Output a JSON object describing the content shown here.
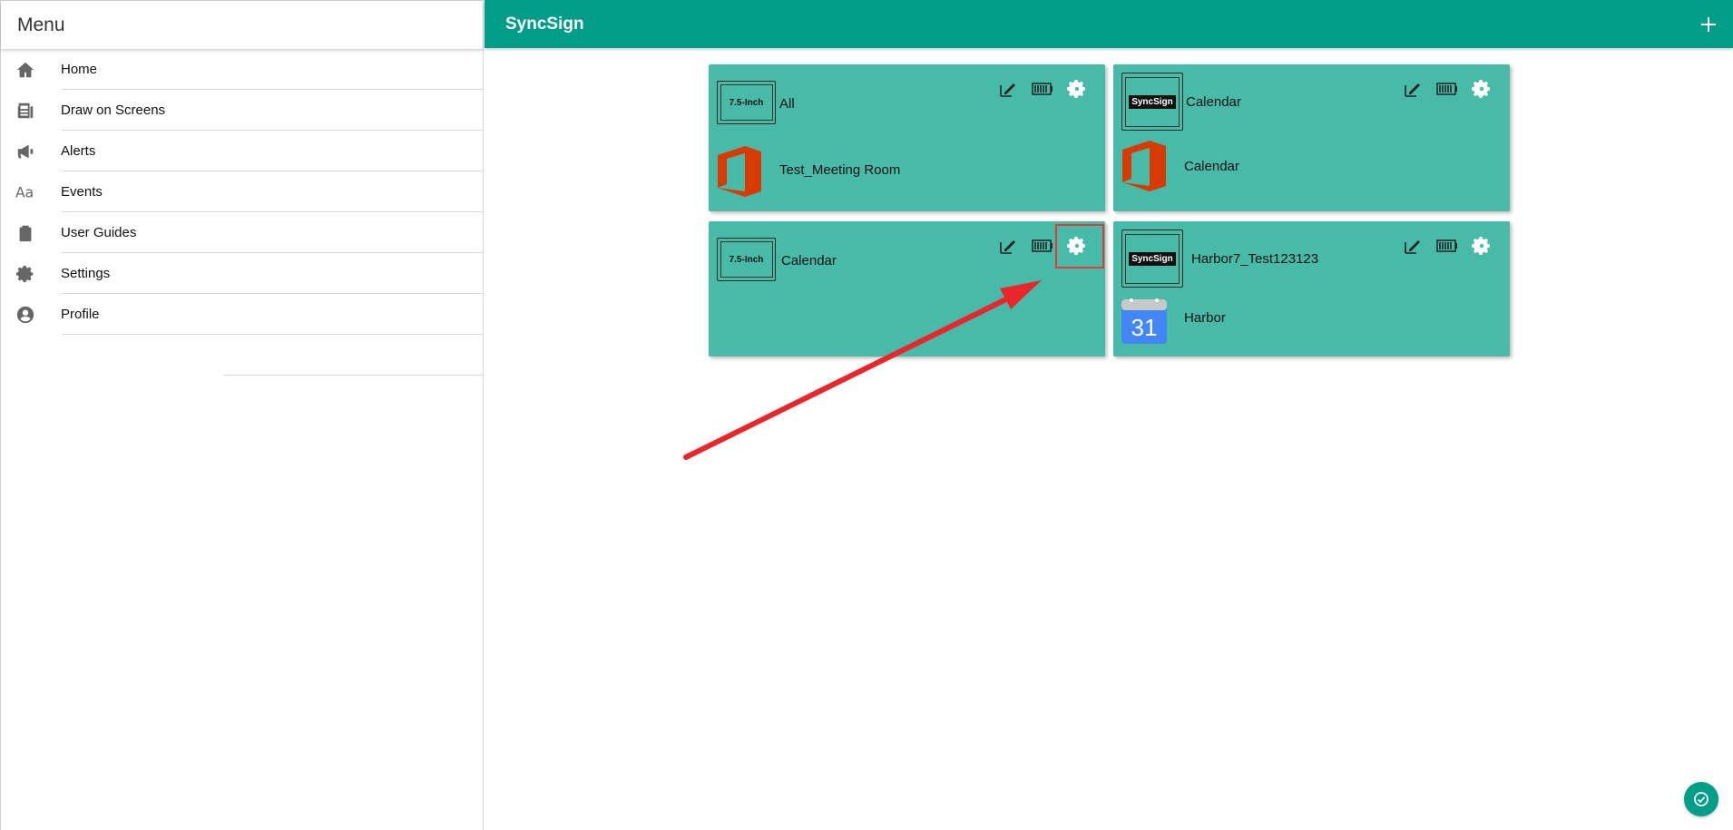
{
  "sidebar": {
    "title": "Menu",
    "items": [
      {
        "label": "Home",
        "icon": "home-icon"
      },
      {
        "label": "Draw on Screens",
        "icon": "newspaper-icon"
      },
      {
        "label": "Alerts",
        "icon": "megaphone-icon"
      },
      {
        "label": "Events",
        "icon": "font-icon"
      },
      {
        "label": "User Guides",
        "icon": "clipboard-icon"
      },
      {
        "label": "Settings",
        "icon": "gear-icon"
      },
      {
        "label": "Profile",
        "icon": "user-circle-icon"
      }
    ]
  },
  "header": {
    "title": "SyncSign",
    "add_icon": "plus-icon"
  },
  "cards": [
    {
      "thumb": "7.5-Inch",
      "name": "All",
      "service": "Test_Meeting Room",
      "service_icon": "office-icon"
    },
    {
      "thumb": "SyncSign",
      "name": "Calendar",
      "service": "Calendar",
      "service_icon": "office-icon"
    },
    {
      "thumb": "7.5-Inch",
      "name": "Calendar",
      "service": "",
      "service_icon": ""
    },
    {
      "thumb": "SyncSign",
      "name": "Harbor7_Test123123",
      "service": "Harbor",
      "service_icon": "google-calendar-icon",
      "calendar_day": "31"
    }
  ],
  "colors": {
    "primary": "#009e89",
    "card": "#47baa8",
    "annotation": "#e53935",
    "office": "#d83b01",
    "google_calendar": "#4285f4"
  }
}
